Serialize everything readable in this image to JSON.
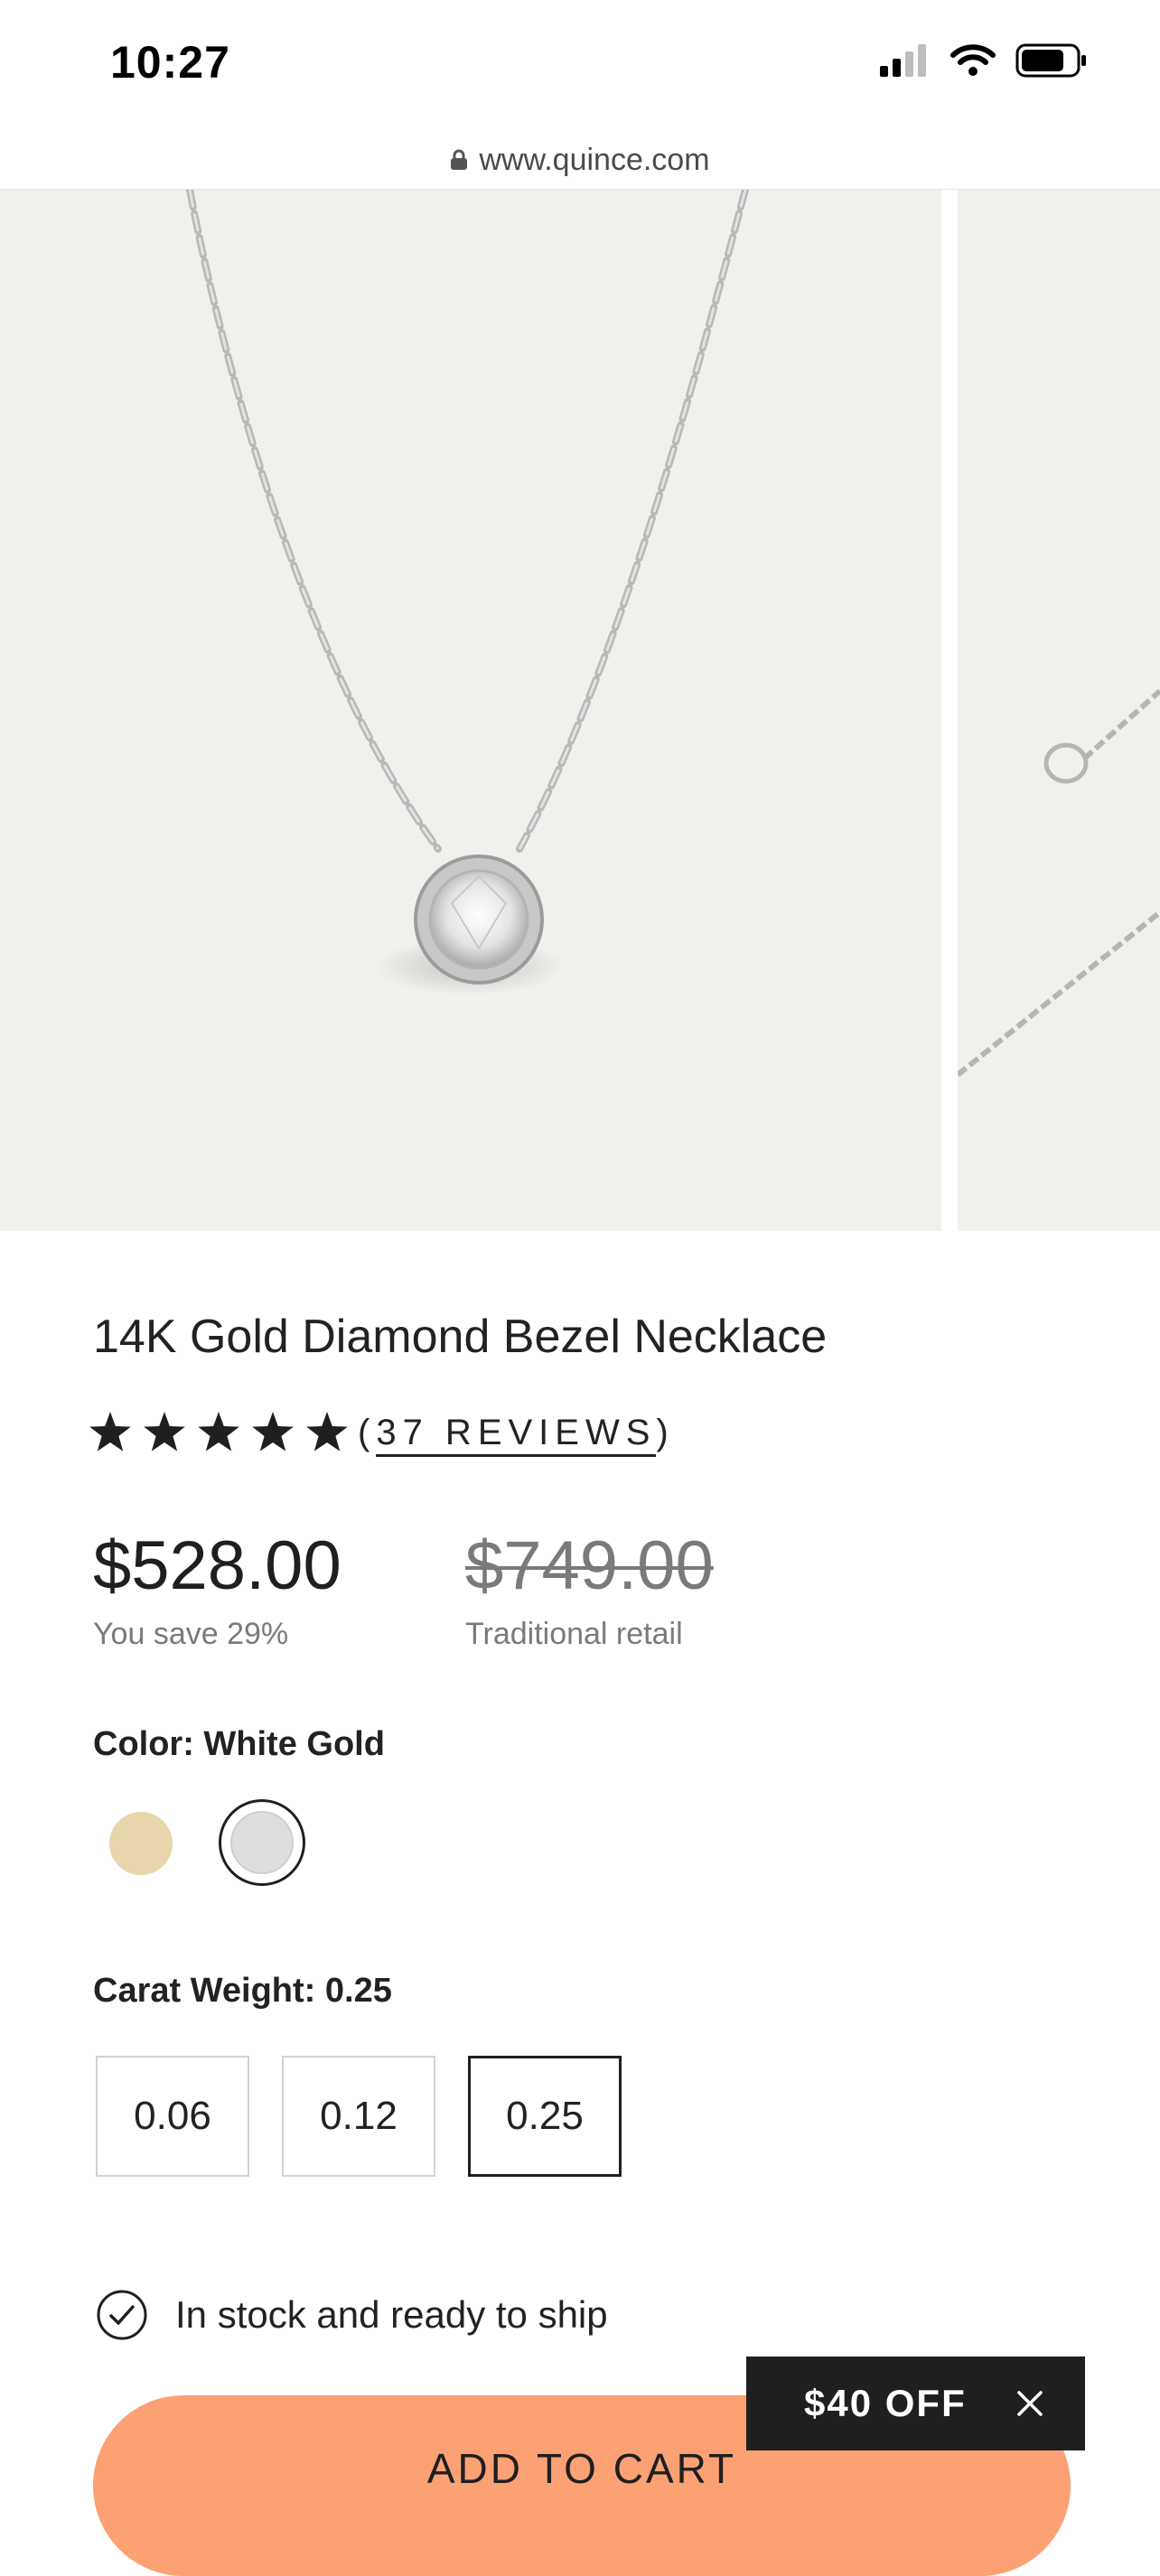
{
  "status_bar": {
    "time": "10:27"
  },
  "browser": {
    "url": "www.quince.com"
  },
  "product": {
    "title": "14K Gold Diamond Bezel Necklace",
    "rating": 5,
    "reviews_open": "(",
    "reviews_label": "37 REVIEWS",
    "reviews_close": ")",
    "price": "$528.00",
    "savings": "You save 29%",
    "retail_price": "$749.00",
    "retail_label": "Traditional retail",
    "color_label": "Color: White Gold",
    "colors": [
      {
        "name": "Yellow Gold",
        "hex": "#e8d6ac",
        "selected": false
      },
      {
        "name": "White Gold",
        "hex": "#dedede",
        "selected": true
      }
    ],
    "carat_label": "Carat Weight: 0.25",
    "carat_options": [
      "0.06",
      "0.12",
      "0.25"
    ],
    "carat_selected": "0.25",
    "stock_text": "In stock and ready to ship",
    "add_to_cart": "ADD TO CART"
  },
  "promo": {
    "label": "$40 OFF"
  },
  "colors": {
    "cta": "#fba174",
    "promo_bg": "#1f1f1f",
    "image_bg": "#f2f0ed"
  }
}
